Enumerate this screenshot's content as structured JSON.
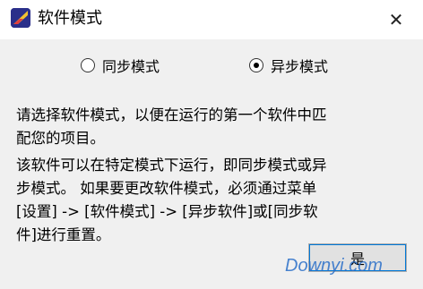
{
  "window": {
    "title": "软件模式",
    "app_icon": "app-logo-icon",
    "close_icon": "close-icon"
  },
  "modes": [
    {
      "label": "同步模式",
      "checked": false
    },
    {
      "label": "异步模式",
      "checked": true
    }
  ],
  "paragraphs": {
    "p1": [
      "请选择软件模式，以便在运行的第一个软件中匹",
      "配您的项目。"
    ],
    "p2": [
      "该软件可以在特定模式下运行，即同步模式或异",
      "步模式。 如果要更改软件模式，必须通过菜单",
      "[设置] -> [软件模式] -> [异步软件]或[同步软",
      "件]进行重置。"
    ]
  },
  "buttons": {
    "ok": "是"
  },
  "watermark": "Downyi.com"
}
